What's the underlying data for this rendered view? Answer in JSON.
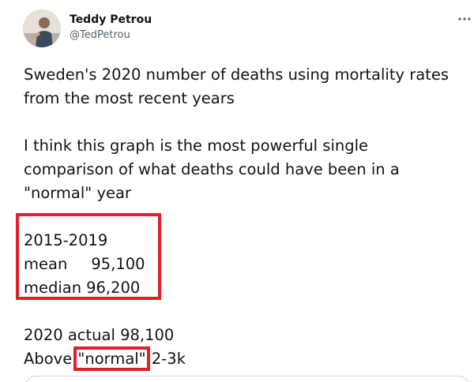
{
  "author": {
    "display_name": "Teddy Petrou",
    "handle": "@TedPetrou",
    "avatar_icon": "profile-photo"
  },
  "menu": {
    "more_icon": "more-horizontal-icon",
    "more_label": "···"
  },
  "tweet": {
    "lines": [
      "Sweden's 2020 number of deaths using mortality rates",
      "from the most recent years",
      "I think this graph is the most powerful single",
      "comparison of what deaths could have been in a",
      "\"normal\" year"
    ],
    "stats": {
      "period": "2015-2019",
      "mean_label": "mean",
      "mean_value": "95,100",
      "median_label": "median",
      "median_value": "96,200"
    },
    "actual_line": "2020 actual 98,100",
    "above_prefix": "Above ",
    "above_highlight": "\"normal\"",
    "above_suffix": " 2-3k"
  },
  "colors": {
    "highlight": "#e0202a",
    "text": "#0f1419",
    "secondary": "#536471",
    "border": "#cfd9de"
  }
}
